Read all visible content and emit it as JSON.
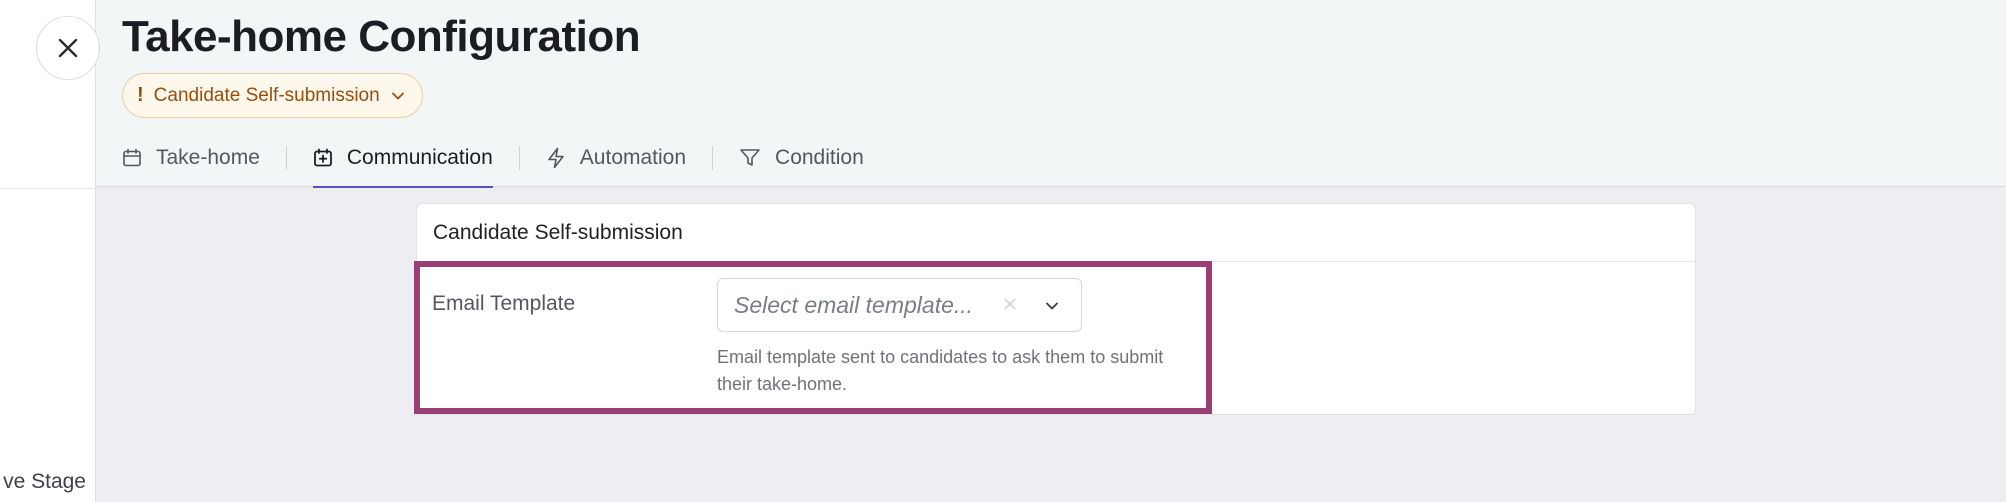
{
  "background": {
    "stage_text": "ve Stage"
  },
  "panel": {
    "title": "Take-home Configuration",
    "stage_chip": {
      "icon_text": "!",
      "label": "Candidate Self-submission"
    },
    "tabs": [
      {
        "label": "Take-home",
        "icon": "calendar-icon",
        "active": false
      },
      {
        "label": "Communication",
        "icon": "calendar-plus-icon",
        "active": true
      },
      {
        "label": "Automation",
        "icon": "lightning-icon",
        "active": false
      },
      {
        "label": "Condition",
        "icon": "filter-icon",
        "active": false
      }
    ]
  },
  "card": {
    "title": "Candidate Self-submission",
    "email_template": {
      "label": "Email Template",
      "placeholder": "Select email template...",
      "help": "Email template sent to candidates to ask them to submit their take-home."
    }
  },
  "colors": {
    "accent": "#5b4ec9",
    "chip_text": "#9a4e0b",
    "highlight": "#9a3f75"
  }
}
